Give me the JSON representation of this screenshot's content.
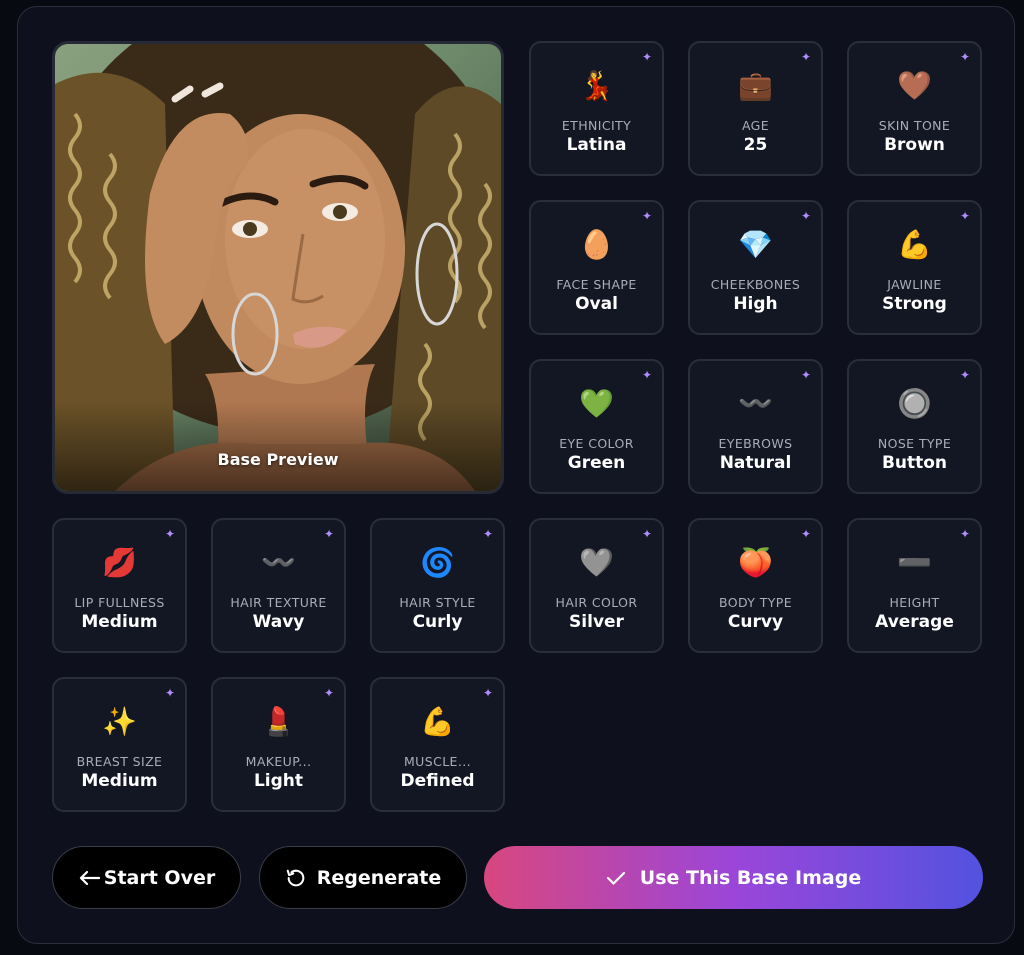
{
  "preview": {
    "label": "Base Preview"
  },
  "attributes": [
    {
      "key": "ethnicity",
      "emoji": "💃",
      "label": "ETHNICITY",
      "value": "Latina"
    },
    {
      "key": "age",
      "emoji": "💼",
      "label": "AGE",
      "value": "25"
    },
    {
      "key": "skin-tone",
      "emoji": "🤎",
      "label": "SKIN TONE",
      "value": "Brown"
    },
    {
      "key": "face-shape",
      "emoji": "🥚",
      "label": "FACE SHAPE",
      "value": "Oval"
    },
    {
      "key": "cheekbones",
      "emoji": "💎",
      "label": "CHEEKBONES",
      "value": "High"
    },
    {
      "key": "jawline",
      "emoji": "💪",
      "label": "JAWLINE",
      "value": "Strong"
    },
    {
      "key": "eye-color",
      "emoji": "💚",
      "label": "EYE COLOR",
      "value": "Green"
    },
    {
      "key": "eyebrows",
      "emoji": "〰️",
      "label": "EYEBROWS",
      "value": "Natural"
    },
    {
      "key": "nose-type",
      "emoji": "🔘",
      "label": "NOSE TYPE",
      "value": "Button"
    },
    {
      "key": "lip-fullness",
      "emoji": "💋",
      "label": "LIP FULLNESS",
      "value": "Medium"
    },
    {
      "key": "hair-texture",
      "emoji": "〰️",
      "label": "HAIR TEXTURE",
      "value": "Wavy"
    },
    {
      "key": "hair-style",
      "emoji": "🌀",
      "label": "HAIR STYLE",
      "value": "Curly"
    },
    {
      "key": "hair-color",
      "emoji": "🩶",
      "label": "HAIR COLOR",
      "value": "Silver"
    },
    {
      "key": "body-type",
      "emoji": "🍑",
      "label": "BODY TYPE",
      "value": "Curvy"
    },
    {
      "key": "height",
      "emoji": "➖",
      "label": "HEIGHT",
      "value": "Average"
    },
    {
      "key": "breast-size",
      "emoji": "✨",
      "label": "BREAST SIZE",
      "value": "Medium"
    },
    {
      "key": "makeup",
      "emoji": "💄",
      "label": "MAKEUP...",
      "value": "Light"
    },
    {
      "key": "muscle",
      "emoji": "💪",
      "label": "MUSCLE...",
      "value": "Defined"
    }
  ],
  "actions": {
    "start_over": "Start Over",
    "regenerate": "Regenerate",
    "use_base": "Use This Base Image"
  },
  "colors": {
    "accent_start": "#d8477f",
    "accent_mid": "#9b46d9",
    "accent_end": "#5352e0",
    "sparkle": "#b18cff"
  },
  "icons": {
    "sparkle": "sparkles-icon",
    "start_over": "arrow-left-icon",
    "regenerate": "rotate-ccw-icon",
    "use_base": "check-icon"
  }
}
